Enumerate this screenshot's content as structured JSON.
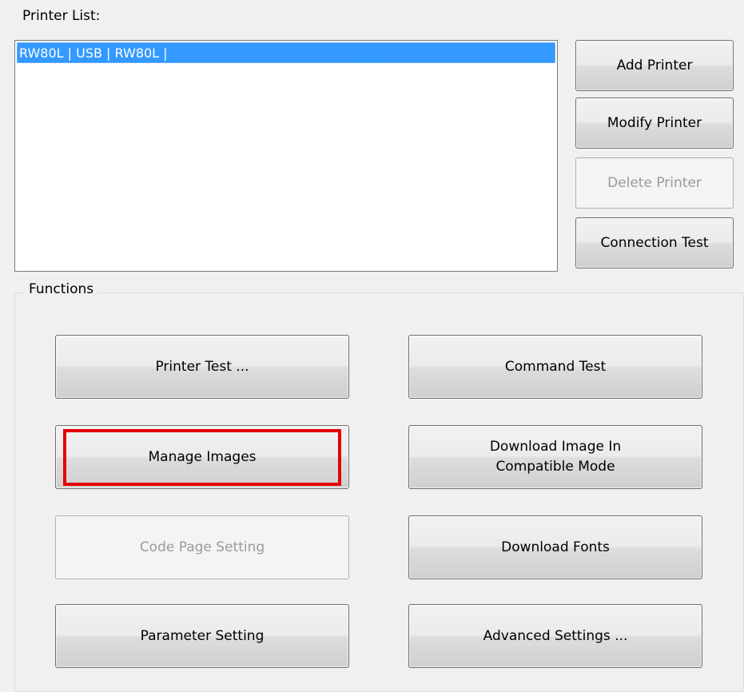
{
  "printer_list": {
    "label": "Printer List:",
    "items": [
      {
        "text": "RW80L | USB | RW80L |",
        "selected": true
      }
    ]
  },
  "printer_buttons": {
    "add": "Add Printer",
    "modify": "Modify Printer",
    "delete": "Delete Printer",
    "connection_test": "Connection Test"
  },
  "functions": {
    "title": "Functions",
    "buttons": [
      {
        "label": "Printer Test ...",
        "enabled": true
      },
      {
        "label": "Command Test",
        "enabled": true
      },
      {
        "label": "Manage Images",
        "enabled": true,
        "highlighted": true
      },
      {
        "label": "Download Image In Compatible Mode",
        "line1": "Download Image In",
        "line2": "Compatible Mode",
        "enabled": true
      },
      {
        "label": "Code Page Setting",
        "enabled": false
      },
      {
        "label": "Download Fonts",
        "enabled": true
      },
      {
        "label": "Parameter Setting",
        "enabled": true
      },
      {
        "label": "Advanced Settings ...",
        "enabled": true
      }
    ]
  },
  "colors": {
    "selection": "#3399ff",
    "highlight_box": "#e60000",
    "disabled_text": "#9a9a9a"
  }
}
